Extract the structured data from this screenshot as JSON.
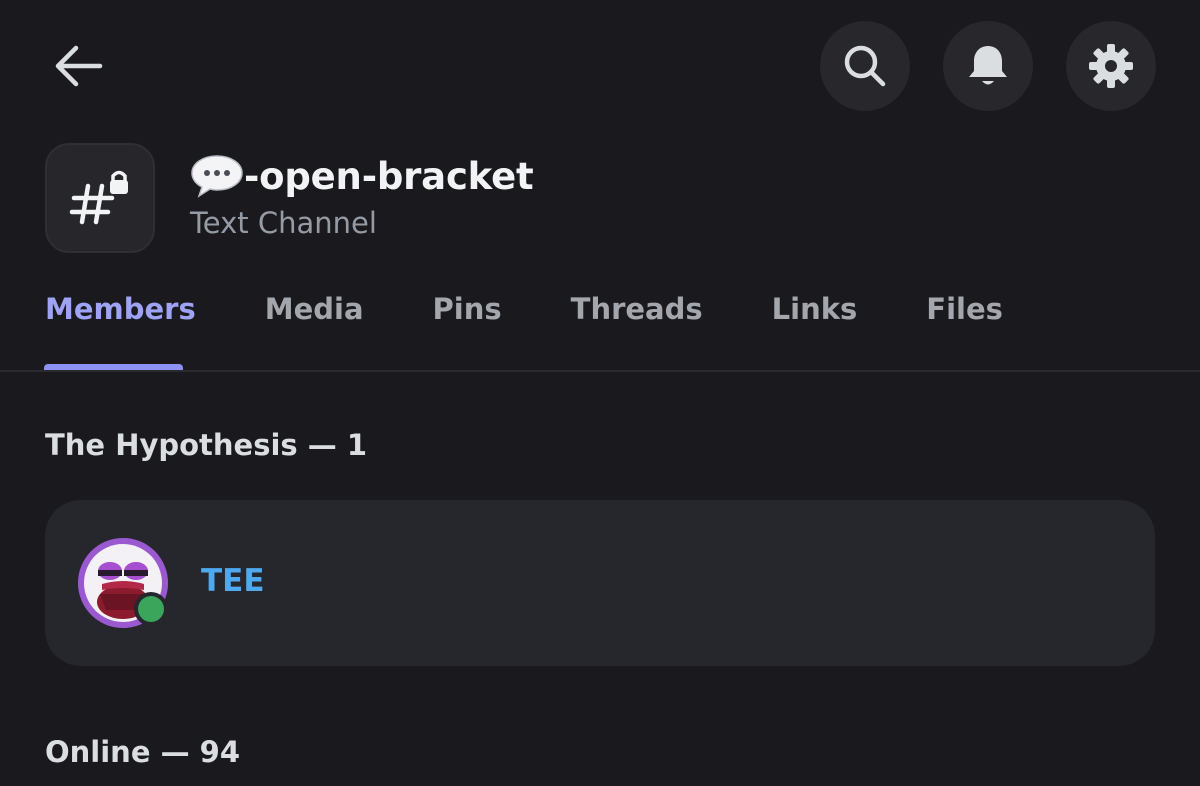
{
  "header": {
    "back_icon": "arrow-left-icon",
    "actions": [
      {
        "icon": "search-icon"
      },
      {
        "icon": "bell-icon"
      },
      {
        "icon": "gear-icon"
      }
    ]
  },
  "channel": {
    "icon": "hashtag-lock-icon",
    "emoji": "speech-bubble-icon",
    "name": "-open-bracket",
    "type": "Text Channel"
  },
  "tabs": [
    {
      "label": "Members",
      "active": true
    },
    {
      "label": "Media",
      "active": false
    },
    {
      "label": "Pins",
      "active": false
    },
    {
      "label": "Threads",
      "active": false
    },
    {
      "label": "Links",
      "active": false
    },
    {
      "label": "Files",
      "active": false
    }
  ],
  "sections": [
    {
      "title": "The Hypothesis — 1",
      "members": [
        {
          "name": "TEE",
          "status": "online",
          "name_color": "#4fa9ef"
        }
      ]
    },
    {
      "title": "Online — 94",
      "members": []
    }
  ],
  "colors": {
    "background": "#1a1a1e",
    "accent": "#8c91f3",
    "online": "#3ba55c"
  }
}
